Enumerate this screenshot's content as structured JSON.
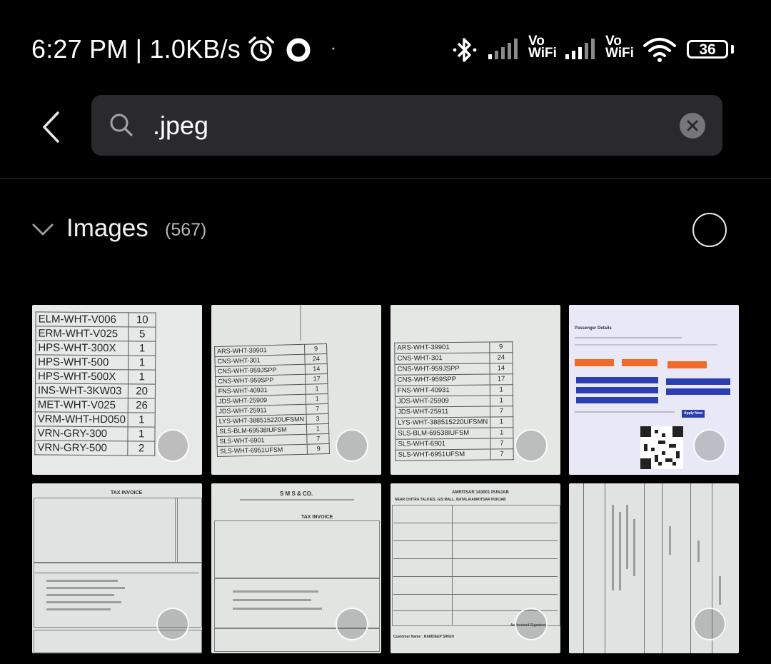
{
  "status_bar": {
    "time": "6:27 PM",
    "net_speed": "1.0KB/s",
    "vowifi_1": [
      "Vo",
      "WiFi"
    ],
    "vowifi_2": [
      "Vo",
      "WiFi"
    ],
    "battery_level": "36",
    "icons": [
      "alarm-icon",
      "ring-icon",
      "bluetooth-icon",
      "signal-icon",
      "wifi-icon",
      "battery-icon"
    ]
  },
  "search": {
    "query": ".jpeg"
  },
  "section": {
    "title": "Images",
    "count": "(567)"
  },
  "thumbs": {
    "t1": [
      [
        "ELM-WHT-V006",
        "10"
      ],
      [
        "ERM-WHT-V025",
        "5"
      ],
      [
        "HPS-WHT-300X",
        "1"
      ],
      [
        "HPS-WHT-500",
        "1"
      ],
      [
        "HPS-WHT-500X",
        "1"
      ],
      [
        "INS-WHT-3KW03",
        "20"
      ],
      [
        "MET-WHT-V025",
        "26"
      ],
      [
        "VRM-WHT-HD050",
        "1"
      ],
      [
        "VRN-GRY-300",
        "1"
      ],
      [
        "VRN-GRY-500",
        "2"
      ]
    ],
    "t2": [
      [
        "ARS-WHT-39901",
        "9"
      ],
      [
        "CNS-WHT-301",
        "24"
      ],
      [
        "CNS-WHT-959JSPP",
        "14"
      ],
      [
        "CNS-WHT-959SPP",
        "17"
      ],
      [
        "FNS-WHT-40931",
        "1"
      ],
      [
        "JDS-WHT-25909",
        "1"
      ],
      [
        "JDS-WHT-25911",
        "7"
      ],
      [
        "LYS-WHT-388515220UFSMN",
        "3"
      ],
      [
        "SLS-BLM-69538IUFSM",
        "1"
      ],
      [
        "SLS-WHT-6901",
        "7"
      ],
      [
        "SLS-WHT-6951UFSM",
        "9"
      ]
    ],
    "t3": [
      [
        "ARS-WHT-39901",
        "9"
      ],
      [
        "CNS-WHT-301",
        "24"
      ],
      [
        "CNS-WHT-959JSPP",
        "14"
      ],
      [
        "CNS-WHT-959SPP",
        "17"
      ],
      [
        "FNS-WHT-40931",
        "1"
      ],
      [
        "JDS-WHT-25909",
        "1"
      ],
      [
        "JDS-WHT-25911",
        "7"
      ],
      [
        "LYS-WHT-388515220UFSMN",
        "1"
      ],
      [
        "SLS-BLM-69538IUFSM",
        "1"
      ],
      [
        "SLS-WHT-6901",
        "7"
      ],
      [
        "SLS-WHT-6951UFSM",
        "7"
      ]
    ],
    "t4": {
      "heading": "Passenger Details",
      "apply_button": "Apply Now"
    },
    "t5": {
      "heading": "TAX INVOICE"
    },
    "t6": {
      "company": "S M S & CO.",
      "heading": "TAX INVOICE"
    },
    "t7": {
      "heading": "AMRITSAR 143001 PUNJAB",
      "destination": "NEAR CHITRA TALKIES, G/S MALL, BATALA/AMRITSAR PUNJAB",
      "footer_left": "Customer Name : RAMDEEP SINGH",
      "footer_right": "Authorised Signatory"
    },
    "t8": {}
  },
  "colors": {
    "background": "#000000",
    "search_bg": "#2a2a2c",
    "button_orange": "#f06a2a",
    "button_blue": "#2c3fb0"
  }
}
